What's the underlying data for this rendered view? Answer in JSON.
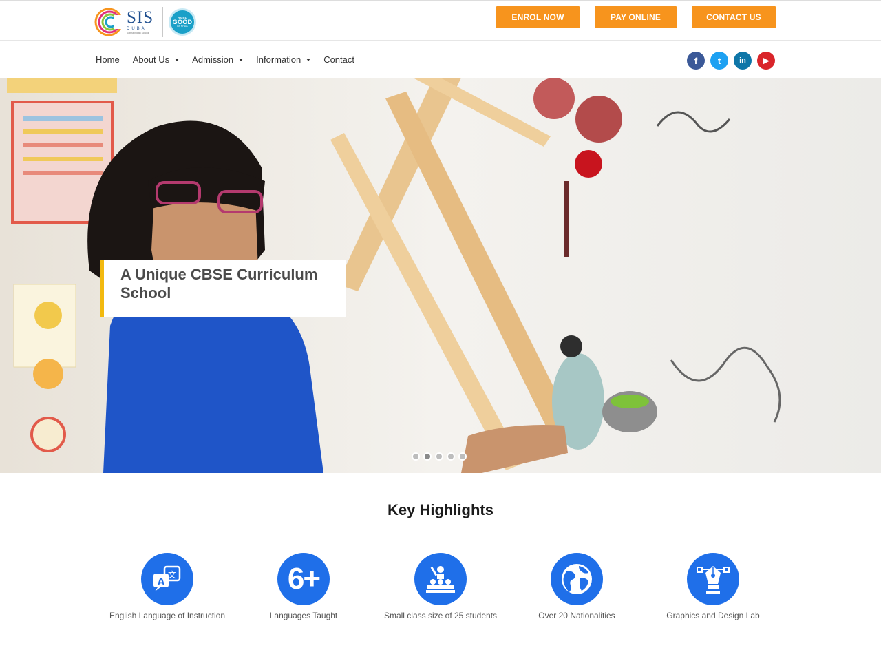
{
  "header": {
    "logo": {
      "name": "SIS",
      "sub": "DUBAI",
      "tagline": "Sobha Indian School",
      "badge_line1": "RATED",
      "badge_line2": "GOOD",
      "badge_line3": "BY KHDA"
    },
    "buttons": {
      "enrol": "ENROL NOW",
      "pay": "PAY ONLINE",
      "contact": "CONTACT US"
    },
    "accent_color": "#f7941d"
  },
  "nav": {
    "items": [
      {
        "label": "Home",
        "has_dropdown": false
      },
      {
        "label": "About Us",
        "has_dropdown": true
      },
      {
        "label": "Admission",
        "has_dropdown": true
      },
      {
        "label": "Information",
        "has_dropdown": true
      },
      {
        "label": "Contact",
        "has_dropdown": false
      }
    ],
    "social": [
      {
        "icon": "facebook-icon",
        "glyph": "f",
        "color": "#3b5998"
      },
      {
        "icon": "twitter-icon",
        "glyph": "t",
        "color": "#1da1f2"
      },
      {
        "icon": "linkedin-icon",
        "glyph": "in",
        "color": "#0e76a8"
      },
      {
        "icon": "youtube-icon",
        "glyph": "▶",
        "color": "#d9252a"
      }
    ]
  },
  "hero": {
    "caption": "A Unique CBSE Curriculum School",
    "slides_total": 5,
    "active_slide": 2,
    "caption_accent": "#f2b90f"
  },
  "highlights": {
    "title": "Key Highlights",
    "icon_color": "#1f6fe9",
    "items": [
      {
        "label": "English Language of Instruction",
        "icon": "translate-icon"
      },
      {
        "label": "Languages Taught",
        "icon": "six-plus-icon",
        "text": "6+"
      },
      {
        "label": "Small class size of 25 students",
        "icon": "classroom-icon"
      },
      {
        "label": "Over 20 Nationalities",
        "icon": "globe-icon"
      },
      {
        "label": "Graphics and Design Lab",
        "icon": "pen-tool-icon"
      }
    ]
  }
}
